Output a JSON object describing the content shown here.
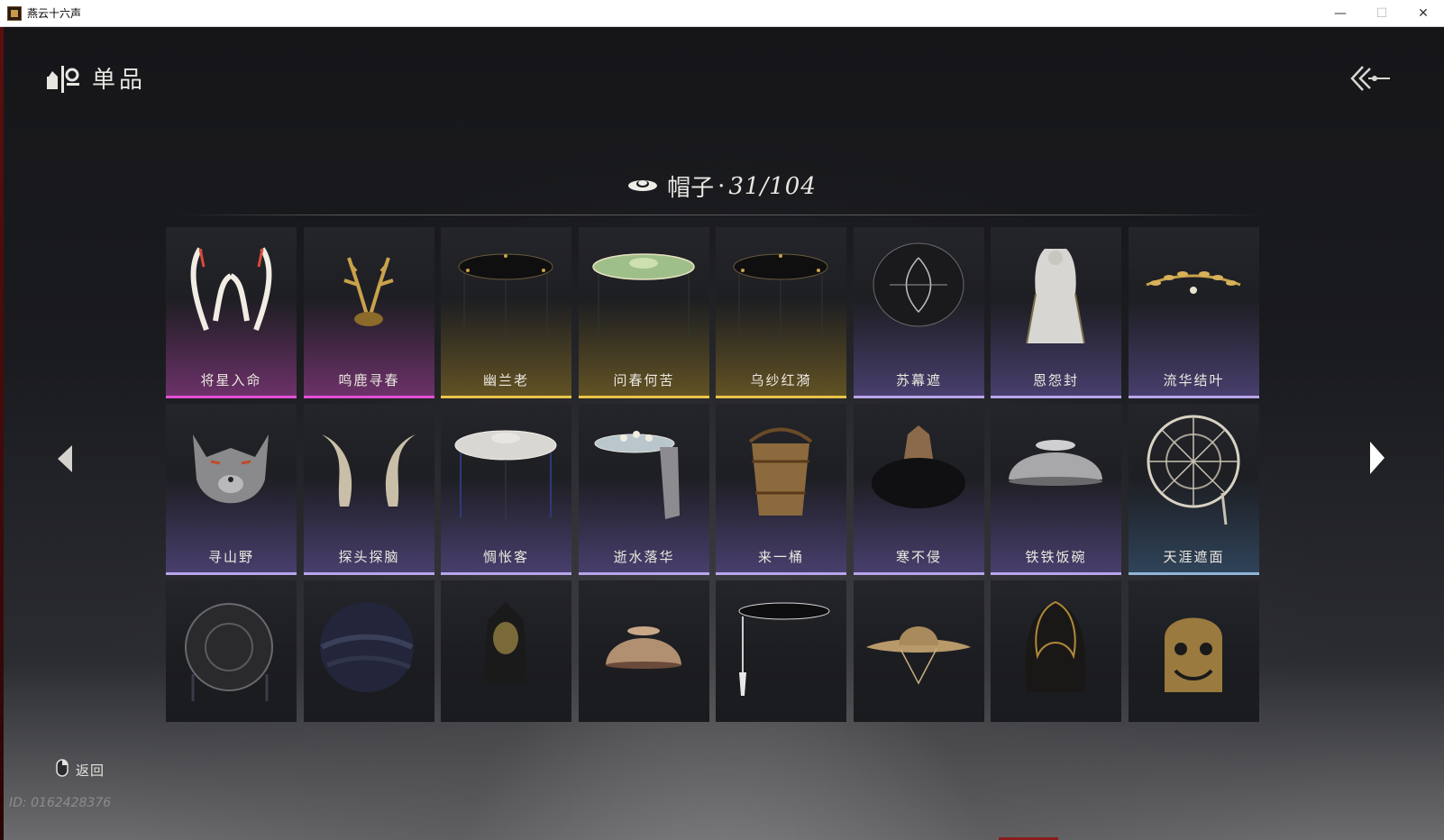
{
  "window": {
    "title": "燕云十六声",
    "minimize_glyph": "—",
    "maximize_glyph": "☐",
    "close_glyph": "✕"
  },
  "header": {
    "title": "单品"
  },
  "category": {
    "name": "帽子",
    "separator": "·",
    "count": "31/104",
    "owned": 31,
    "total": 104
  },
  "items": [
    {
      "name": "将星入命",
      "rarity": "pink",
      "icon": "white-antlers-icon"
    },
    {
      "name": "鸣鹿寻春",
      "rarity": "pink",
      "icon": "golden-antlers-icon"
    },
    {
      "name": "幽兰老",
      "rarity": "gold",
      "icon": "black-veiled-hat-icon"
    },
    {
      "name": "问春何苦",
      "rarity": "gold",
      "icon": "green-veiled-hat-icon"
    },
    {
      "name": "乌纱红漪",
      "rarity": "gold",
      "icon": "black-veiled-hat-icon"
    },
    {
      "name": "苏幕遮",
      "rarity": "purple",
      "icon": "embroidered-round-hat-icon"
    },
    {
      "name": "恩怨封",
      "rarity": "purple",
      "icon": "white-hood-icon"
    },
    {
      "name": "流华结叶",
      "rarity": "purple",
      "icon": "laurel-crown-icon"
    },
    {
      "name": "寻山野",
      "rarity": "purple",
      "icon": "wolf-head-icon"
    },
    {
      "name": "探头探脑",
      "rarity": "purple",
      "icon": "feathers-icon"
    },
    {
      "name": "惆怅客",
      "rarity": "purple",
      "icon": "white-veiled-hat-icon"
    },
    {
      "name": "逝水落华",
      "rarity": "purple",
      "icon": "flower-scarf-hat-icon"
    },
    {
      "name": "来一桶",
      "rarity": "purple",
      "icon": "barrel-hat-icon"
    },
    {
      "name": "寒不侵",
      "rarity": "purple",
      "icon": "fur-hat-icon"
    },
    {
      "name": "铁铁饭碗",
      "rarity": "purple",
      "icon": "iron-bowl-icon"
    },
    {
      "name": "天涯遮面",
      "rarity": "blue",
      "icon": "rattan-frame-hat-icon"
    },
    {
      "name": "",
      "rarity": "none",
      "icon": "woven-round-hat-icon"
    },
    {
      "name": "",
      "rarity": "none",
      "icon": "dark-wrapped-hat-icon"
    },
    {
      "name": "",
      "rarity": "none",
      "icon": "dark-helmet-icon"
    },
    {
      "name": "",
      "rarity": "none",
      "icon": "clay-bowl-icon"
    },
    {
      "name": "",
      "rarity": "none",
      "icon": "tasseled-flat-hat-icon"
    },
    {
      "name": "",
      "rarity": "none",
      "icon": "straw-hat-icon"
    },
    {
      "name": "",
      "rarity": "none",
      "icon": "dark-hood-icon"
    },
    {
      "name": "",
      "rarity": "none",
      "icon": "bronze-mask-icon"
    }
  ],
  "footer": {
    "back_label": "返回",
    "user_id": "ID: 0162428376"
  },
  "colors": {
    "pink": "#e24fd6",
    "gold": "#e8c548",
    "purple": "#b9a5ea",
    "blue": "#8fb6d8"
  }
}
